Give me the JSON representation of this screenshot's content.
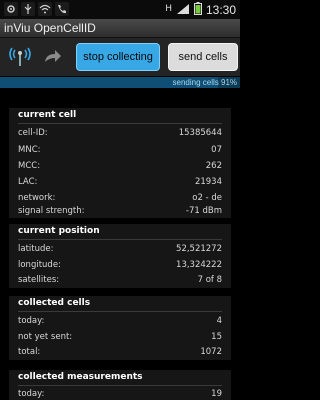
{
  "status_bar": {
    "left_icons": [
      "settings-icon",
      "bluetooth-icon",
      "wifi-icon",
      "phone-icon"
    ],
    "network_indicator": "H",
    "time": "13:30"
  },
  "app": {
    "title": "inViu OpenCellID"
  },
  "toolbar": {
    "stop_label": "stop collecting",
    "send_label": "send cells"
  },
  "progress": {
    "text": "sending cells 91%",
    "value": 0.91
  },
  "current_cell": {
    "title": "current cell",
    "rows": [
      {
        "label": "cell-ID:",
        "value": "15385644"
      },
      {
        "label": "MNC:",
        "value": "07"
      },
      {
        "label": "MCC:",
        "value": "262"
      },
      {
        "label": "LAC:",
        "value": "21934"
      },
      {
        "label": "network:",
        "value": "o2 - de"
      },
      {
        "label": "signal strength:",
        "value": "-71 dBm"
      }
    ]
  },
  "current_position": {
    "title": "current position",
    "rows": [
      {
        "label": "latitude:",
        "value": "52,521272"
      },
      {
        "label": "longitude:",
        "value": "13,324222"
      },
      {
        "label": "satellites:",
        "value": "7 of 8"
      }
    ]
  },
  "collected_cells": {
    "title": "collected cells",
    "rows": [
      {
        "label": "today:",
        "value": "4"
      },
      {
        "label": "not yet sent:",
        "value": "15"
      },
      {
        "label": "total:",
        "value": "1072"
      }
    ]
  },
  "collected_measurements": {
    "title": "collected measurements",
    "rows": [
      {
        "label": "today:",
        "value": "19"
      }
    ]
  },
  "colors": {
    "accent_blue": "#38a7e6",
    "progress_bg": "#0e3b55",
    "progress_fill": "#0f4f75"
  }
}
